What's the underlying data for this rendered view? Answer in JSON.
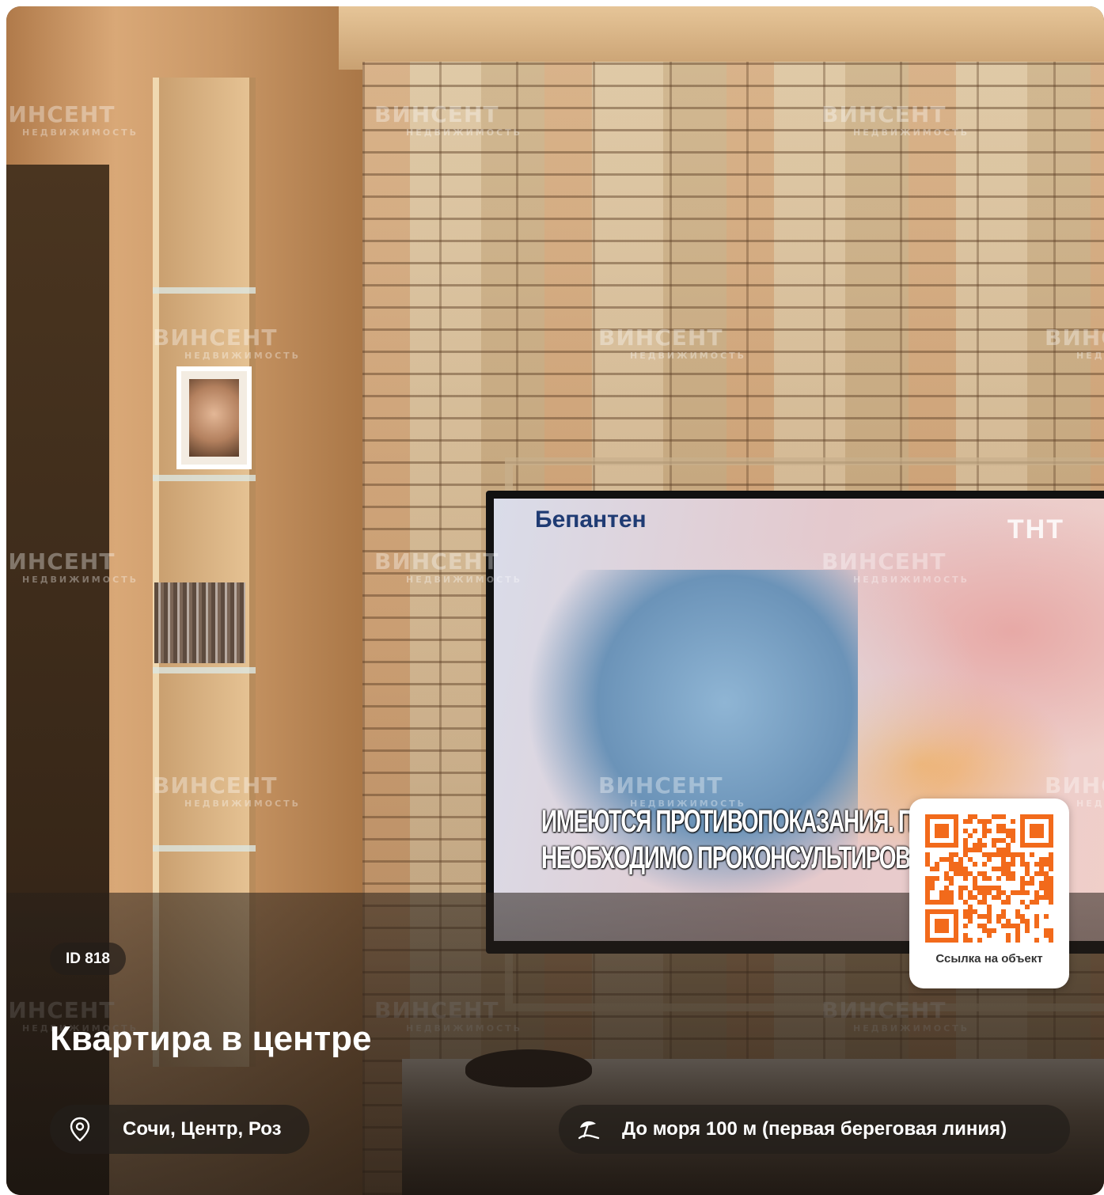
{
  "listing": {
    "id_label": "ID 818",
    "title": "Квартира в центре",
    "location": "Сочи, Центр, Роз",
    "sea_distance": "До моря 100 м (первая береговая линия)",
    "qr_caption": "Ссылка на объект"
  },
  "photo": {
    "watermark_text": "ВИНСЕНТ",
    "watermark_subtext": "НЕДВИЖИМОСТЬ",
    "tv_brand": "Бепантен",
    "tv_channel_logo": "ТНТ",
    "tv_subtitle_line1": "ИМЕЮТСЯ ПРОТИВОПОКАЗАНИЯ. ПЕРЕД ПР",
    "tv_subtitle_line2": "НЕОБХОДИМО ПРОКОНСУЛЬТИРОВАТЬСЯ СО СП"
  },
  "icons": {
    "location": "map-pin-icon",
    "sea": "beach-umbrella-icon"
  },
  "colors": {
    "qr_accent": "#f26a1b",
    "overlay": "#1e1914",
    "text": "#ffffff"
  }
}
